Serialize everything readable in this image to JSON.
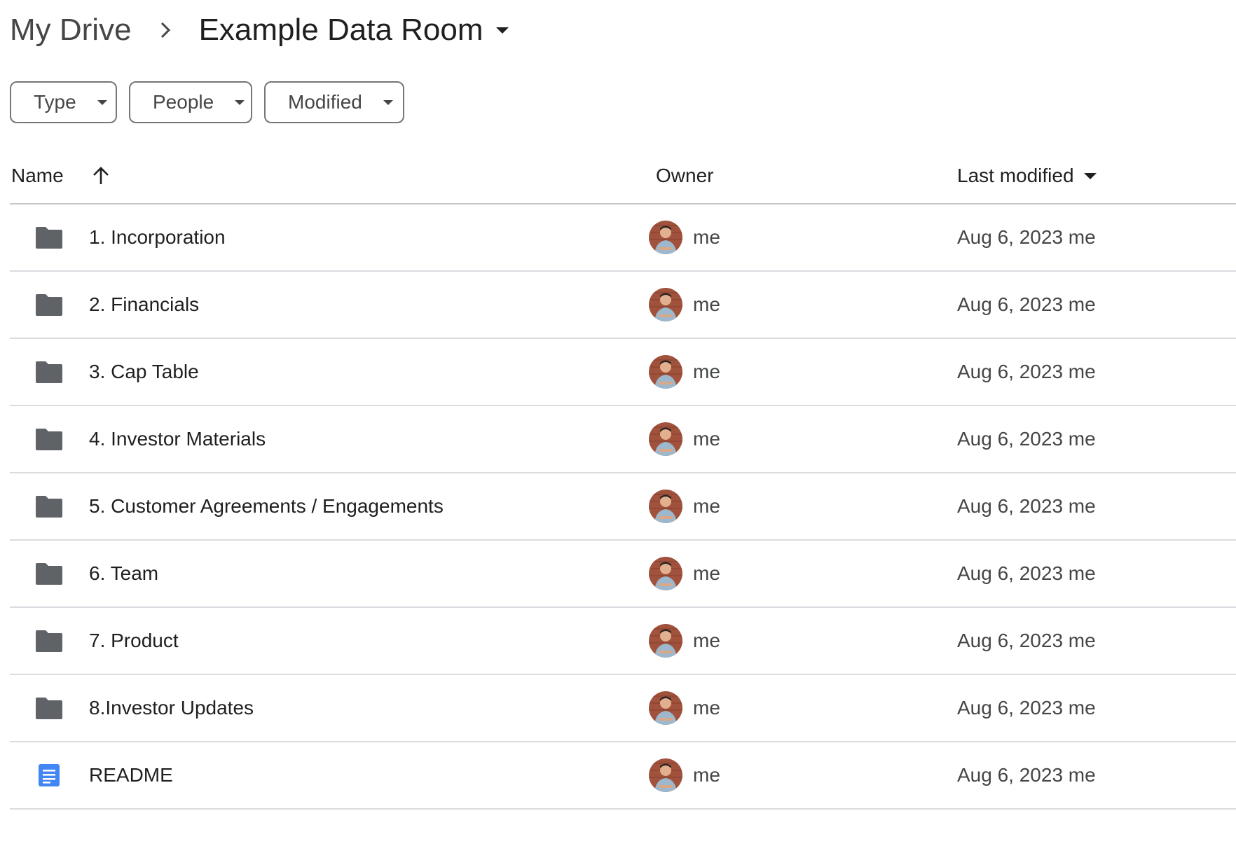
{
  "breadcrumb": {
    "root": "My Drive",
    "separator_icon": "chevron-right-icon",
    "current": "Example Data Room"
  },
  "filters": {
    "type": "Type",
    "people": "People",
    "modified": "Modified"
  },
  "table": {
    "headers": {
      "name": "Name",
      "owner": "Owner",
      "last_modified": "Last modified"
    },
    "sort": "name-ascending",
    "rows": [
      {
        "name": "1. Incorporation",
        "icon": "folder-icon",
        "owner": "me",
        "modified": "Aug 6, 2023 me"
      },
      {
        "name": "2. Financials",
        "icon": "folder-icon",
        "owner": "me",
        "modified": "Aug 6, 2023 me"
      },
      {
        "name": "3. Cap Table",
        "icon": "folder-icon",
        "owner": "me",
        "modified": "Aug 6, 2023 me"
      },
      {
        "name": "4. Investor Materials",
        "icon": "folder-icon",
        "owner": "me",
        "modified": "Aug 6, 2023 me"
      },
      {
        "name": "5. Customer Agreements / Engagements",
        "icon": "folder-icon",
        "owner": "me",
        "modified": "Aug 6, 2023 me"
      },
      {
        "name": "6. Team",
        "icon": "folder-icon",
        "owner": "me",
        "modified": "Aug 6, 2023 me"
      },
      {
        "name": "7. Product",
        "icon": "folder-icon",
        "owner": "me",
        "modified": "Aug 6, 2023 me"
      },
      {
        "name": "8.Investor Updates",
        "icon": "folder-icon",
        "owner": "me",
        "modified": "Aug 6, 2023 me"
      },
      {
        "name": "README",
        "icon": "google-doc-icon",
        "owner": "me",
        "modified": "Aug 6, 2023 me"
      }
    ]
  },
  "colors": {
    "folder": "#5f6368",
    "doc": "#4285f4",
    "divider": "#dadce0"
  }
}
